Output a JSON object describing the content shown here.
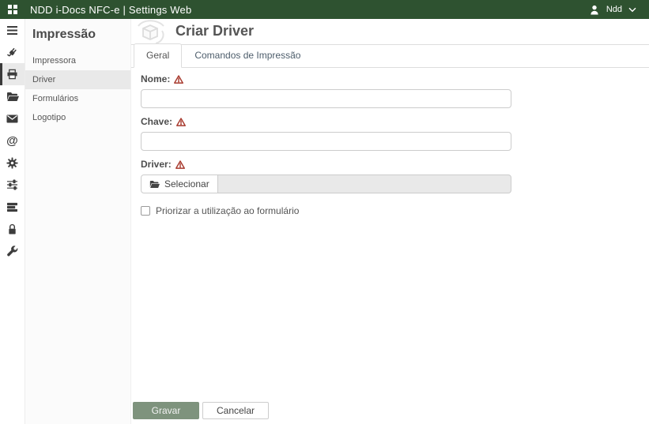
{
  "colors": {
    "topbar_bg": "#2e5230",
    "save_button_bg": "#7e937d",
    "warning": "#a83a2e",
    "selected_row_bg": "#e9e9e9"
  },
  "topbar": {
    "title": "NDD i-Docs NFC-e | Settings Web",
    "logo_icon": "apps-grid-icon",
    "user": {
      "name": "Ndd",
      "icon": "person-icon",
      "menu_icon": "chevron-down-icon"
    }
  },
  "iconbar": {
    "items": [
      {
        "icon": "menu-icon",
        "active": false
      },
      {
        "icon": "plug-icon",
        "active": false
      },
      {
        "icon": "printer-icon",
        "active": true
      },
      {
        "icon": "folder-open-icon",
        "active": false
      },
      {
        "icon": "mail-icon",
        "active": false
      },
      {
        "icon": "at-sign-icon",
        "active": false
      },
      {
        "icon": "gear-icon",
        "active": false
      },
      {
        "icon": "sliders-icon",
        "active": false
      },
      {
        "icon": "server-icon",
        "active": false
      },
      {
        "icon": "lock-icon",
        "active": false
      },
      {
        "icon": "wrench-icon",
        "active": false
      }
    ]
  },
  "panel": {
    "title": "Impressão",
    "items": [
      {
        "label": "Impressora",
        "active": false
      },
      {
        "label": "Driver",
        "active": true
      },
      {
        "label": "Formulários",
        "active": false
      },
      {
        "label": "Logotipo",
        "active": false
      }
    ]
  },
  "main": {
    "title": "Criar Driver",
    "title_icon": "package-cube-icon",
    "tabs": [
      {
        "label": "Geral",
        "active": true
      },
      {
        "label": "Comandos de Impressão",
        "active": false
      }
    ],
    "form": {
      "fields": [
        {
          "label": "Nome:",
          "required": true,
          "value": ""
        },
        {
          "label": "Chave:",
          "required": true,
          "value": ""
        },
        {
          "label": "Driver:",
          "required": true,
          "value": "",
          "select_button_label": "Selecionar"
        }
      ],
      "checkbox": {
        "label": "Priorizar a utilização ao formulário",
        "checked": false
      }
    },
    "footer": {
      "save_label": "Gravar",
      "cancel_label": "Cancelar"
    }
  }
}
